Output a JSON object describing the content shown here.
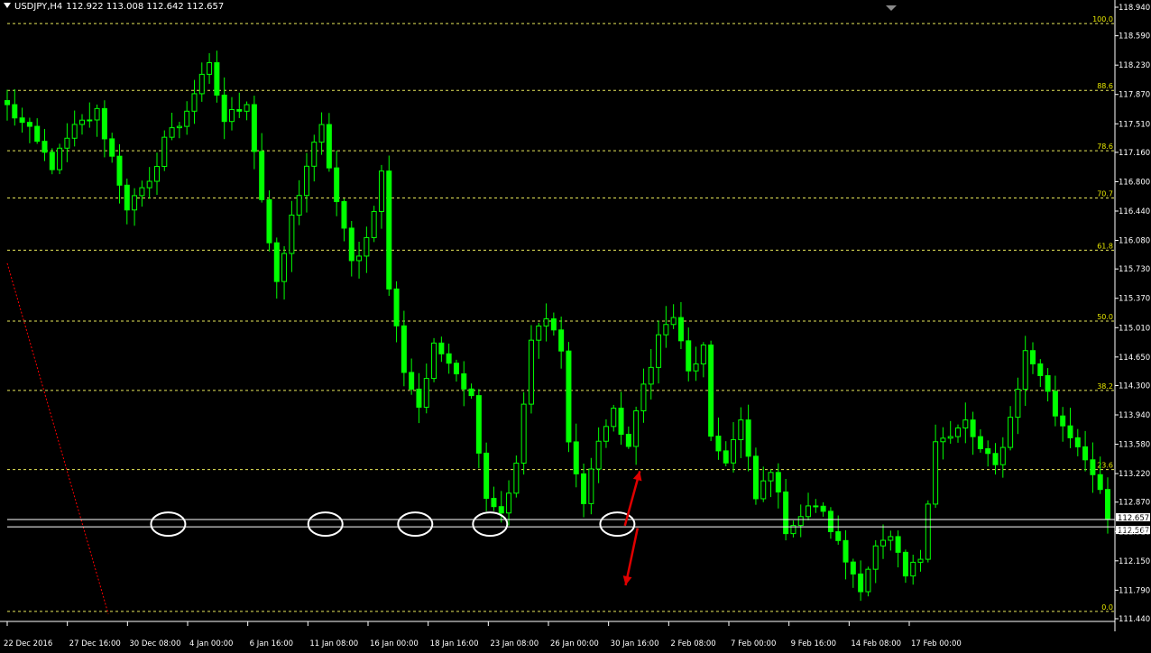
{
  "header": {
    "symbol": "USDJPY,H4",
    "ohlc": "112.922 113.008 112.642 112.657"
  },
  "colors": {
    "background": "#000000",
    "axis": "#ffffff",
    "candles": "#00ff00",
    "fib_levels": "#e8e85a",
    "fib_labels": "#e8e800",
    "support_lines": "#ffffff",
    "trendline": "#ff0000",
    "arrows": "#e00000",
    "markers": "#ffffff"
  },
  "chart_data": {
    "type": "candlestick",
    "ylim": [
      111.44,
      118.94
    ],
    "y_ticks": [
      "118.940",
      "118.590",
      "118.230",
      "117.870",
      "117.510",
      "117.160",
      "116.800",
      "116.440",
      "116.080",
      "115.730",
      "115.370",
      "115.010",
      "114.650",
      "114.300",
      "113.940",
      "113.580",
      "113.220",
      "112.870",
      "112.510",
      "112.150",
      "111.790",
      "111.440"
    ],
    "x_ticks": [
      "22 Dec 2016",
      "27 Dec 16:00",
      "30 Dec 08:00",
      "4 Jan 00:00",
      "6 Jan 16:00",
      "11 Jan 08:00",
      "16 Jan 00:00",
      "18 Jan 16:00",
      "23 Jan 08:00",
      "26 Jan 00:00",
      "30 Jan 16:00",
      "2 Feb 08:00",
      "7 Feb 00:00",
      "9 Feb 16:00",
      "14 Feb 08:00",
      "17 Feb 00:00"
    ],
    "close_path": [
      [
        0,
        117.72
      ],
      [
        3,
        117.4
      ],
      [
        6,
        117.0
      ],
      [
        9,
        117.45
      ],
      [
        12,
        117.65
      ],
      [
        14,
        117.1
      ],
      [
        16,
        116.5
      ],
      [
        19,
        116.75
      ],
      [
        21,
        117.35
      ],
      [
        23,
        117.5
      ],
      [
        25,
        117.9
      ],
      [
        27,
        118.2
      ],
      [
        29,
        117.55
      ],
      [
        32,
        117.8
      ],
      [
        34,
        116.6
      ],
      [
        36,
        115.5
      ],
      [
        38,
        116.35
      ],
      [
        40,
        117.0
      ],
      [
        42,
        117.45
      ],
      [
        44,
        116.55
      ],
      [
        46,
        115.8
      ],
      [
        48,
        116.1
      ],
      [
        50,
        116.9
      ],
      [
        51,
        115.5
      ],
      [
        53,
        114.5
      ],
      [
        55,
        114.05
      ],
      [
        57,
        114.75
      ],
      [
        59,
        114.65
      ],
      [
        62,
        114.15
      ],
      [
        64,
        112.95
      ],
      [
        66,
        112.75
      ],
      [
        68,
        113.3
      ],
      [
        70,
        114.85
      ],
      [
        72,
        115.1
      ],
      [
        74,
        114.8
      ],
      [
        75,
        113.6
      ],
      [
        77,
        112.85
      ],
      [
        79,
        113.65
      ],
      [
        81,
        113.95
      ],
      [
        83,
        113.55
      ],
      [
        85,
        114.3
      ],
      [
        87,
        114.9
      ],
      [
        89,
        115.15
      ],
      [
        91,
        114.45
      ],
      [
        93,
        114.75
      ],
      [
        94,
        113.6
      ],
      [
        96,
        113.4
      ],
      [
        98,
        113.85
      ],
      [
        100,
        112.9
      ],
      [
        102,
        113.3
      ],
      [
        104,
        112.55
      ],
      [
        106,
        112.7
      ],
      [
        108,
        112.85
      ],
      [
        110,
        112.55
      ],
      [
        112,
        112.15
      ],
      [
        114,
        111.85
      ],
      [
        116,
        112.3
      ],
      [
        118,
        112.4
      ],
      [
        120,
        111.95
      ],
      [
        122,
        112.2
      ],
      [
        124,
        113.65
      ],
      [
        126,
        113.65
      ],
      [
        128,
        113.85
      ],
      [
        130,
        113.5
      ],
      [
        132,
        113.3
      ],
      [
        134,
        113.9
      ],
      [
        136,
        114.7
      ],
      [
        138,
        114.45
      ],
      [
        140,
        113.95
      ],
      [
        142,
        113.7
      ],
      [
        144,
        113.45
      ],
      [
        146,
        112.95
      ],
      [
        147,
        112.66
      ]
    ],
    "candle_count": 148,
    "candle_tail": [
      [
        130,
        113.5
      ],
      [
        132,
        113.3
      ],
      [
        134,
        114.55
      ],
      [
        136,
        114.7
      ],
      [
        138,
        114.45
      ],
      [
        140,
        113.95
      ],
      [
        142,
        113.7
      ],
      [
        144,
        113.45
      ],
      [
        146,
        112.95
      ],
      [
        147,
        112.66
      ]
    ],
    "fib_levels": [
      {
        "label": "100.0",
        "price": 118.74
      },
      {
        "label": "88.6",
        "price": 117.92
      },
      {
        "label": "78.6",
        "price": 117.18
      },
      {
        "label": "70.7",
        "price": 116.6
      },
      {
        "label": "61.8",
        "price": 115.96
      },
      {
        "label": "50.0",
        "price": 115.09
      },
      {
        "label": "38.2",
        "price": 114.24
      },
      {
        "label": "23.6",
        "price": 113.27
      },
      {
        "label": "0.0",
        "price": 111.53
      }
    ],
    "horizontal_lines": [
      {
        "label": "112.657",
        "price": 112.657
      },
      {
        "label": "112.567",
        "price": 112.567
      }
    ],
    "circled_lows": [
      21.5,
      42.5,
      54.5,
      64.5,
      81.5
    ],
    "trendline": {
      "from": [
        0,
        115.8
      ],
      "to": [
        13.5,
        111.5
      ]
    },
    "arrows": [
      {
        "from": [
          82.5,
          112.58
        ],
        "to": [
          84.5,
          113.25
        ]
      },
      {
        "from": [
          84.2,
          112.55
        ],
        "to": [
          82.6,
          111.85
        ]
      }
    ]
  }
}
